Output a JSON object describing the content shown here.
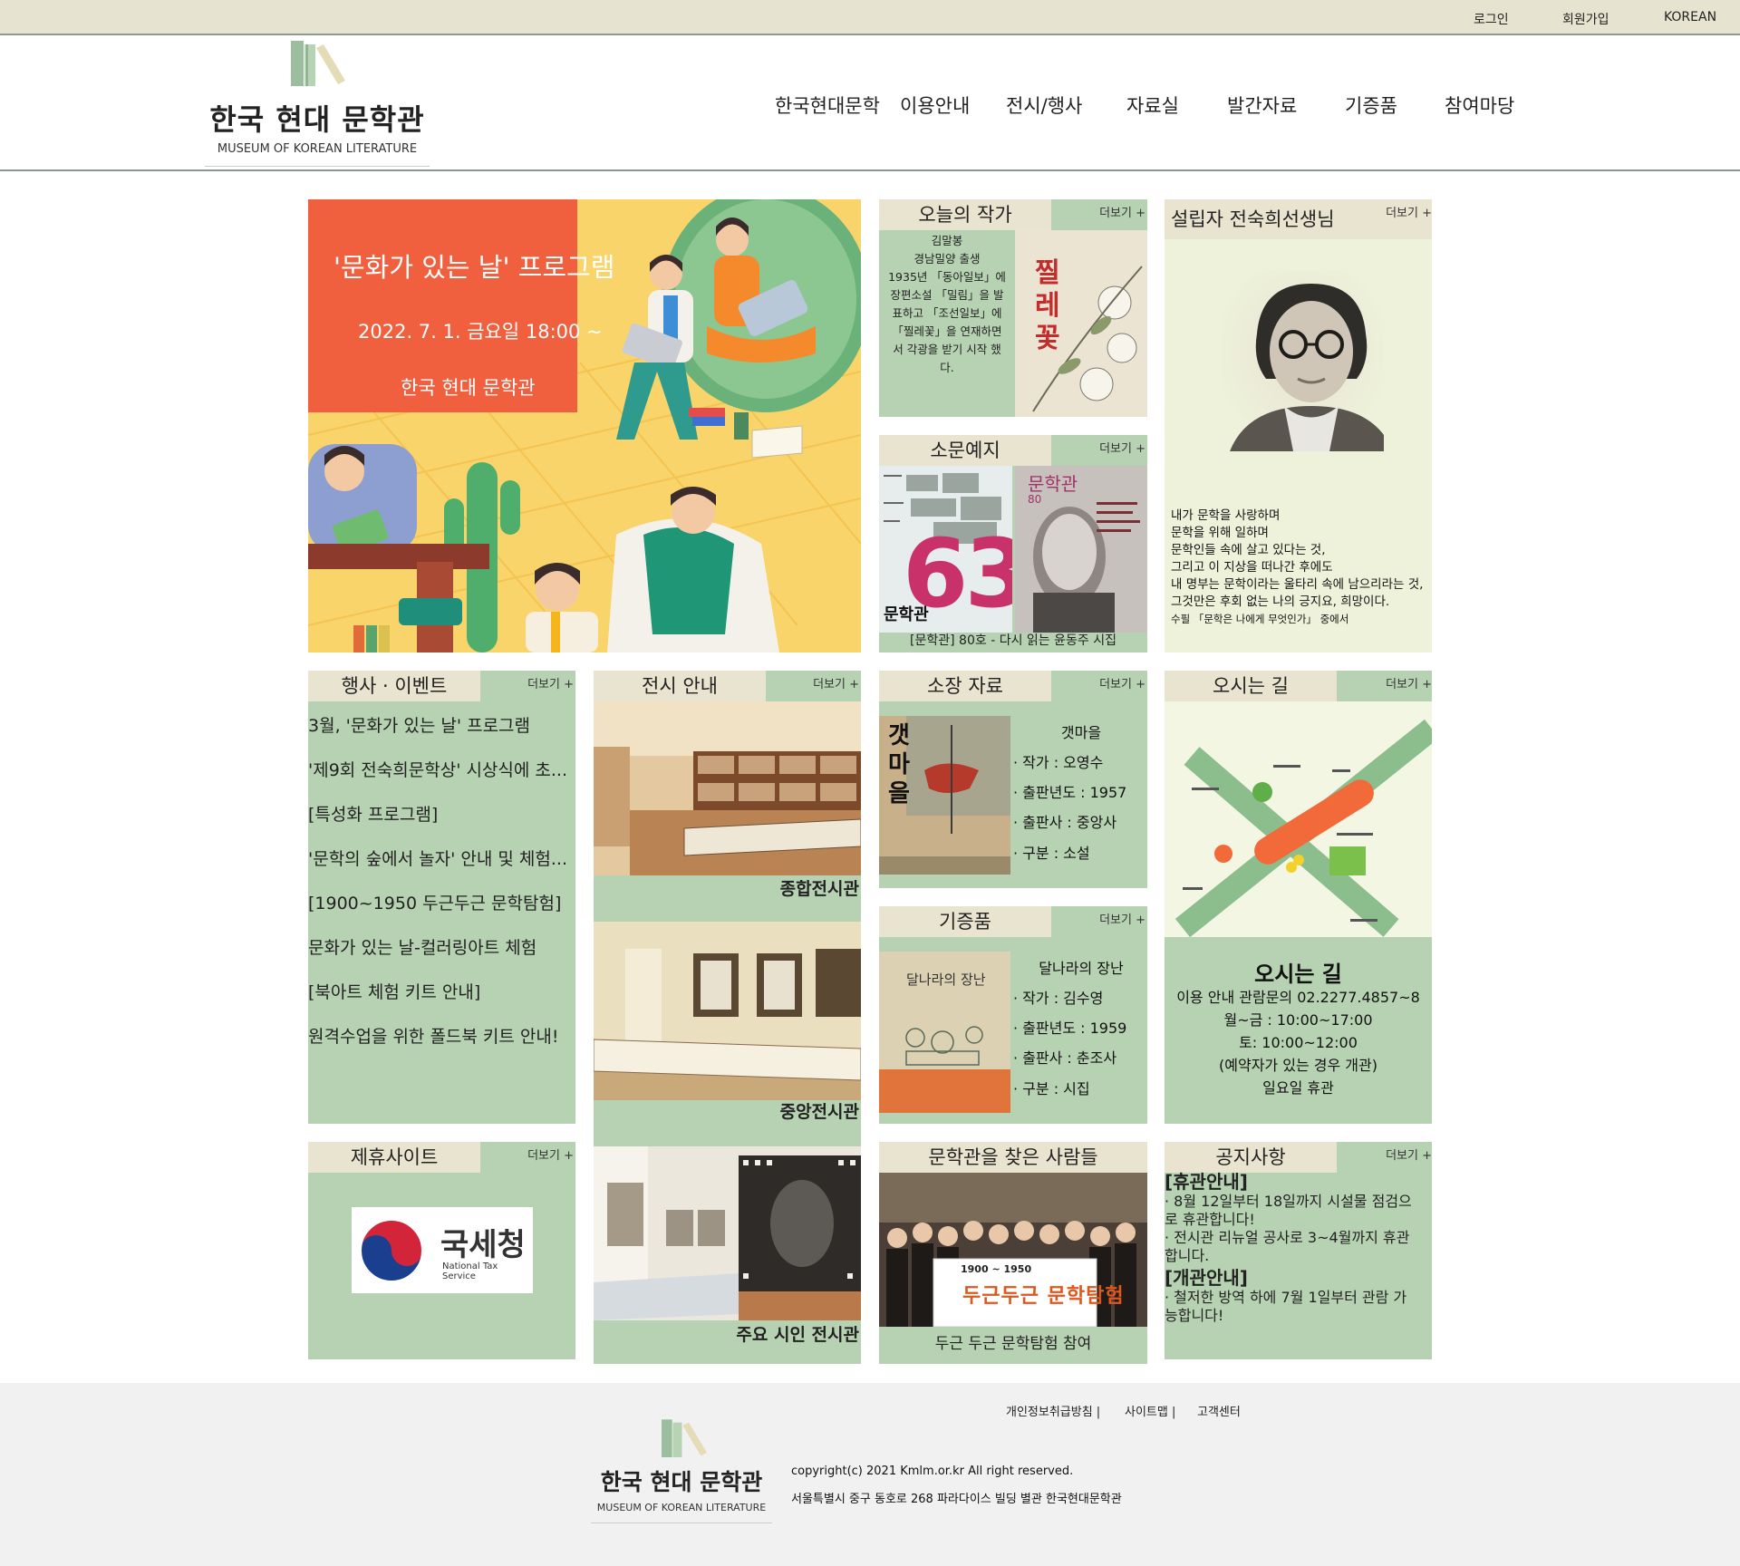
{
  "topbar": {
    "login": "로그인",
    "signup": "회원가입",
    "language": "KOREAN"
  },
  "logo": {
    "name": "한국 현대 문학관",
    "english": "MUSEUM OF KOREAN LITERATURE"
  },
  "nav": [
    "한국현대문학",
    "이용안내",
    "전시/행사",
    "자료실",
    "발간자료",
    "기증품",
    "참여마당"
  ],
  "more_label": "더보기 +",
  "hero": {
    "title": "'문화가 있는 날' 프로그램",
    "date": "2022. 7. 1. 금요일 18:00 ~",
    "org": "한국 현대 문학관"
  },
  "todays_author": {
    "tab": "오늘의 작가",
    "text": [
      "김말봉",
      "경남밀양 출생",
      "1935년 「동아일보」에",
      "장편소설 「밀림」을 발",
      "표하고 「조선일보」에",
      "「찔레꽃」을 연재하면",
      "서 각광을 받기 시작 했",
      "다."
    ],
    "cover_title": "찔레꽃"
  },
  "journal": {
    "tab": "소문예지",
    "caption": "[문학관] 80호 - 다시 읽는 윤동주 시집",
    "cover1_number": "63",
    "cover1_title": "문학관",
    "cover2_title": "문학관",
    "cover2_number": "80"
  },
  "founder": {
    "tab": "설립자 전숙희선생님",
    "quote": [
      "내가 문학을 사랑하며",
      "문학을 위해 일하며",
      "문학인들 속에 살고 있다는 것,",
      "그리고 이 지상을 떠나간 후에도",
      "내 명부는 문학이라는 울타리 속에 남으리라는 것,",
      "그것만은 후회 없는 나의 긍지요, 희망이다."
    ],
    "source": "수필 「문학은 나에게 무엇인가」 중에서"
  },
  "events": {
    "tab": "행사 · 이벤트",
    "items": [
      "3월, '문화가 있는 날' 프로그램",
      "'제9회 전숙희문학상' 시상식에 초...",
      "[특성화 프로그램]",
      "'문학의 숲에서 놀자' 안내 및 체험...",
      "[1900~1950 두근두근 문학탐험]",
      "문화가 있는 날-컬러링아트 체험",
      "[북아트 체험 키트 안내]",
      "원격수업을 위한 폴드북 키트 안내!"
    ]
  },
  "exhibition": {
    "tab": "전시 안내",
    "halls": [
      "종합전시관",
      "중앙전시관",
      "주요 시인 전시관"
    ]
  },
  "collection": {
    "tab": "소장 자료",
    "title": "갯마을",
    "cover_title": "갯마을",
    "specs": [
      "· 작가 : 오영수",
      "· 출판년도 : 1957",
      "· 출판사 : 중앙사",
      "· 구분 : 소설"
    ]
  },
  "donation": {
    "tab": "기증품",
    "title": "달나라의 장난",
    "cover_title": "달나라의 장난",
    "specs": [
      "· 작가 : 김수영",
      "· 출판년도 : 1959",
      "· 출판사 : 춘조사",
      "· 구분 : 시집"
    ]
  },
  "directions": {
    "tab": "오시는 길",
    "heading": "오시는 길",
    "lines": [
      "이용 안내 관람문의 02.2277.4857~8",
      "월~금 : 10:00~17:00",
      "토: 10:00~12:00",
      "(예약자가 있는 경우 개관)",
      "일요일 휴관"
    ]
  },
  "partners": {
    "tab": "제휴사이트",
    "logo_kr": "국세청",
    "logo_en": "National Tax Service"
  },
  "visitors": {
    "tab": "문학관을 찾은 사람들",
    "caption": "두근 두근 문학탐험 참여",
    "banner_year": "1900 ~ 1950",
    "banner_title": "두근두근 문학탐험"
  },
  "notices": {
    "tab": "공지사항",
    "blocks": [
      {
        "heading": "[휴관안내]",
        "lines": [
          "·  8월 12일부터 18일까지 시설물 점검으",
          "로 휴관합니다!",
          "·  전시관 리뉴얼 공사로 3~4월까지 휴관",
          "합니다."
        ]
      },
      {
        "heading": "[개관안내]",
        "lines": [
          "·  철저한 방역 하에 7월 1일부터 관람 가",
          "능합니다!"
        ]
      }
    ]
  },
  "footer": {
    "links": [
      "개인정보취급방침 |",
      "사이트맵 |",
      "고객센터"
    ],
    "copyright": "copyright(c) 2021 Kmlm.or.kr All right reserved.",
    "address": "서울특별시 중구 동호로 268 파라다이스 빌딩 별관 한국현대문학관"
  },
  "colors": {
    "panel_green": "#b7d2b2",
    "tab_beige": "#e8e4cf",
    "topbar": "#e6e4d0",
    "hero_orange": "#f0603e",
    "hero_yellow": "#f9d46b"
  }
}
